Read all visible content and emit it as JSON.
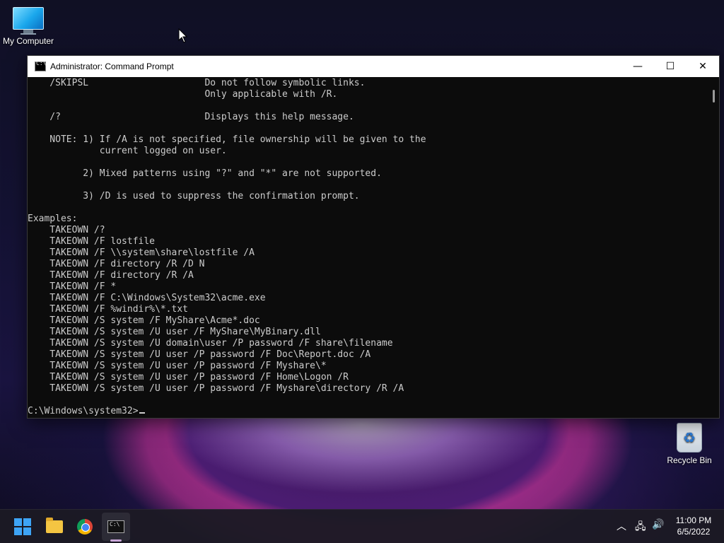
{
  "desktop": {
    "my_computer_label": "My Computer",
    "recycle_bin_label": "Recycle Bin"
  },
  "window": {
    "title": "Administrator: Command Prompt",
    "icon_label": "C:\\",
    "minimize_glyph": "—",
    "maximize_glyph": "☐",
    "close_glyph": "✕"
  },
  "console": {
    "lines": [
      "    /SKIPSL                     Do not follow symbolic links.",
      "                                Only applicable with /R.",
      "",
      "    /?                          Displays this help message.",
      "",
      "    NOTE: 1) If /A is not specified, file ownership will be given to the",
      "             current logged on user.",
      "",
      "          2) Mixed patterns using \"?\" and \"*\" are not supported.",
      "",
      "          3) /D is used to suppress the confirmation prompt.",
      "",
      "Examples:",
      "    TAKEOWN /?",
      "    TAKEOWN /F lostfile",
      "    TAKEOWN /F \\\\system\\share\\lostfile /A",
      "    TAKEOWN /F directory /R /D N",
      "    TAKEOWN /F directory /R /A",
      "    TAKEOWN /F *",
      "    TAKEOWN /F C:\\Windows\\System32\\acme.exe",
      "    TAKEOWN /F %windir%\\*.txt",
      "    TAKEOWN /S system /F MyShare\\Acme*.doc",
      "    TAKEOWN /S system /U user /F MyShare\\MyBinary.dll",
      "    TAKEOWN /S system /U domain\\user /P password /F share\\filename",
      "    TAKEOWN /S system /U user /P password /F Doc\\Report.doc /A",
      "    TAKEOWN /S system /U user /P password /F Myshare\\*",
      "    TAKEOWN /S system /U user /P password /F Home\\Logon /R",
      "    TAKEOWN /S system /U user /P password /F Myshare\\directory /R /A",
      ""
    ],
    "prompt": "C:\\Windows\\system32>"
  },
  "taskbar": {
    "icons": [
      "windows-start-icon",
      "file-explorer-icon",
      "chrome-icon",
      "command-prompt-icon"
    ],
    "tray": {
      "chevron": "︿",
      "network": "🖧",
      "volume": "🔊"
    },
    "clock_time": "11:00 PM",
    "clock_date": "6/5/2022"
  }
}
